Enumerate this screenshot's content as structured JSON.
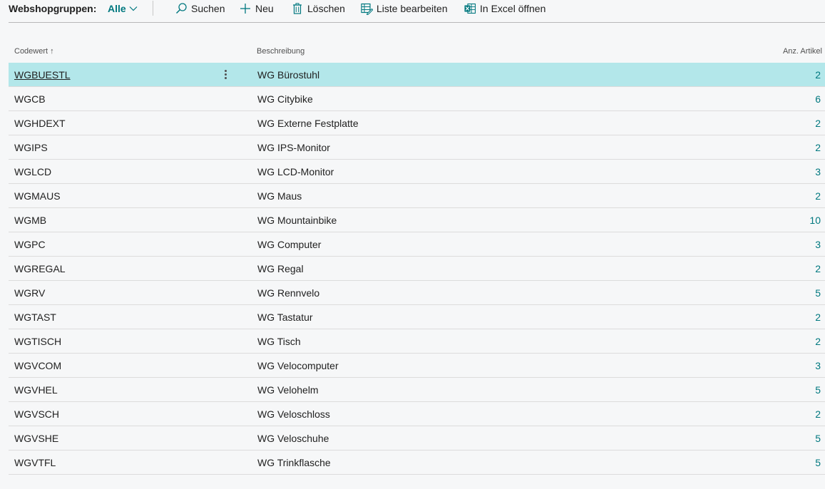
{
  "header": {
    "title": "Webshopgruppen:",
    "filter_value": "Alle"
  },
  "actions": [
    {
      "label": "Suchen",
      "icon": "search-icon"
    },
    {
      "label": "Neu",
      "icon": "plus-icon"
    },
    {
      "label": "Löschen",
      "icon": "trash-icon"
    },
    {
      "label": "Liste bearbeiten",
      "icon": "edit-list-icon"
    },
    {
      "label": "In Excel öffnen",
      "icon": "excel-icon"
    }
  ],
  "colors": {
    "accent": "#00787f",
    "selected_row": "#b3e7ea",
    "background": "#f6f7f8"
  },
  "table": {
    "columns": {
      "code": "Codewert",
      "code_sort": "↑",
      "description": "Beschreibung",
      "count": "Anz. Artikel"
    },
    "selected_index": 0,
    "rows": [
      {
        "code": "WGBUESTL",
        "description": "WG Bürostuhl",
        "count": "2"
      },
      {
        "code": "WGCB",
        "description": "WG Citybike",
        "count": "6"
      },
      {
        "code": "WGHDEXT",
        "description": "WG Externe Festplatte",
        "count": "2"
      },
      {
        "code": "WGIPS",
        "description": "WG IPS-Monitor",
        "count": "2"
      },
      {
        "code": "WGLCD",
        "description": "WG LCD-Monitor",
        "count": "3"
      },
      {
        "code": "WGMAUS",
        "description": "WG Maus",
        "count": "2"
      },
      {
        "code": "WGMB",
        "description": "WG Mountainbike",
        "count": "10"
      },
      {
        "code": "WGPC",
        "description": "WG Computer",
        "count": "3"
      },
      {
        "code": "WGREGAL",
        "description": "WG Regal",
        "count": "2"
      },
      {
        "code": "WGRV",
        "description": "WG Rennvelo",
        "count": "5"
      },
      {
        "code": "WGTAST",
        "description": "WG Tastatur",
        "count": "2"
      },
      {
        "code": "WGTISCH",
        "description": "WG Tisch",
        "count": "2"
      },
      {
        "code": "WGVCOM",
        "description": "WG Velocomputer",
        "count": "3"
      },
      {
        "code": "WGVHEL",
        "description": "WG Velohelm",
        "count": "5"
      },
      {
        "code": "WGVSCH",
        "description": "WG Veloschloss",
        "count": "2"
      },
      {
        "code": "WGVSHE",
        "description": "WG Veloschuhe",
        "count": "5"
      },
      {
        "code": "WGVTFL",
        "description": "WG Trinkflasche",
        "count": "5"
      }
    ]
  }
}
